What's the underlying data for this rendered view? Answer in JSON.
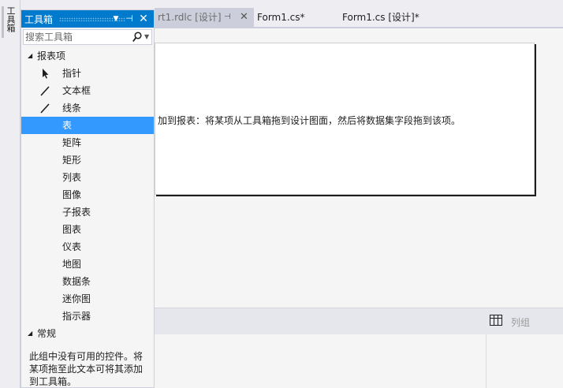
{
  "side_strip": {
    "tab_label": "工具箱"
  },
  "editor_tabs": [
    {
      "label": "rt1.rdlc [设计]"
    },
    {
      "label": "Form1.cs*"
    },
    {
      "label": "Form1.cs [设计]*"
    }
  ],
  "report": {
    "hint": "加到报表：将某项从工具箱拖到设计图面，然后将数据集字段拖到该项。"
  },
  "grouping": {
    "column_group_label": "列组"
  },
  "toolbox": {
    "title": "工具箱",
    "search_placeholder": "搜索工具箱",
    "groups": [
      {
        "label": "报表项",
        "items": [
          {
            "label": "指针",
            "icon": "pointer-icon"
          },
          {
            "label": "文本框",
            "icon": "textbox-icon"
          },
          {
            "label": "线条",
            "icon": "line-icon"
          },
          {
            "label": "表",
            "icon": "table-icon",
            "selected": true
          },
          {
            "label": "矩阵",
            "icon": "matrix-icon"
          },
          {
            "label": "矩形",
            "icon": "rectangle-icon"
          },
          {
            "label": "列表",
            "icon": "list-icon"
          },
          {
            "label": "图像",
            "icon": "image-icon"
          },
          {
            "label": "子报表",
            "icon": "subreport-icon"
          },
          {
            "label": "图表",
            "icon": "chart-icon"
          },
          {
            "label": "仪表",
            "icon": "gauge-icon"
          },
          {
            "label": "地图",
            "icon": "map-icon"
          },
          {
            "label": "数据条",
            "icon": "databar-icon"
          },
          {
            "label": "迷你图",
            "icon": "sparkline-icon"
          },
          {
            "label": "指示器",
            "icon": "indicator-icon"
          }
        ]
      },
      {
        "label": "常规",
        "empty_text": "此组中没有可用的控件。将某项拖至此文本可将其添加到工具箱。"
      }
    ]
  }
}
